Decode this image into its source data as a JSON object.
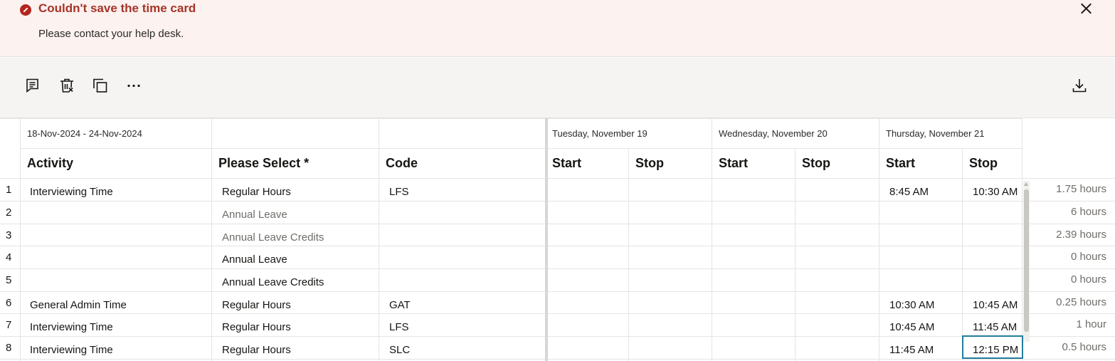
{
  "banner": {
    "title": "Couldn't save the time card",
    "message": "Please contact your help desk.",
    "icon": "error-icon",
    "close_icon": "close-icon",
    "accent_color": "#a63428"
  },
  "toolbar": {
    "icons": [
      "comment-icon",
      "delete-icon",
      "copy-icon",
      "more-icon",
      "download-icon"
    ]
  },
  "grid": {
    "period": "18-Nov-2024 - 24-Nov-2024",
    "days": [
      "Tuesday, November 19",
      "Wednesday, November 20",
      "Thursday, November 21"
    ],
    "headers": {
      "activity": "Activity",
      "please_select": "Please Select *",
      "code": "Code",
      "start": "Start",
      "stop": "Stop"
    },
    "rows": [
      {
        "num": "1",
        "activity": "Interviewing Time",
        "type": "Regular Hours",
        "code": "LFS",
        "thu_start": "8:45 AM",
        "thu_stop": "10:30 AM",
        "hours": "1.75 hours"
      },
      {
        "num": "2",
        "activity": "",
        "type": "Annual Leave",
        "code": "",
        "thu_start": "",
        "thu_stop": "",
        "hours": "6 hours"
      },
      {
        "num": "3",
        "activity": "",
        "type": "Annual Leave Credits",
        "code": "",
        "thu_start": "",
        "thu_stop": "",
        "hours": "2.39 hours"
      },
      {
        "num": "4",
        "activity": "",
        "type": "Annual Leave",
        "code": "",
        "thu_start": "",
        "thu_stop": "",
        "hours": "0 hours"
      },
      {
        "num": "5",
        "activity": "",
        "type": "Annual Leave Credits",
        "code": "",
        "thu_start": "",
        "thu_stop": "",
        "hours": "0 hours"
      },
      {
        "num": "6",
        "activity": "General Admin Time",
        "type": "Regular Hours",
        "code": "GAT",
        "thu_start": "10:30 AM",
        "thu_stop": "10:45 AM",
        "hours": "0.25 hours"
      },
      {
        "num": "7",
        "activity": "Interviewing Time",
        "type": "Regular Hours",
        "code": "LFS",
        "thu_start": "10:45 AM",
        "thu_stop": "11:45 AM",
        "hours": "1 hour"
      },
      {
        "num": "8",
        "activity": "Interviewing Time",
        "type": "Regular Hours",
        "code": "SLC",
        "thu_start": "11:45 AM",
        "thu_stop": "12:15 PM",
        "hours": "0.5 hours"
      }
    ]
  }
}
